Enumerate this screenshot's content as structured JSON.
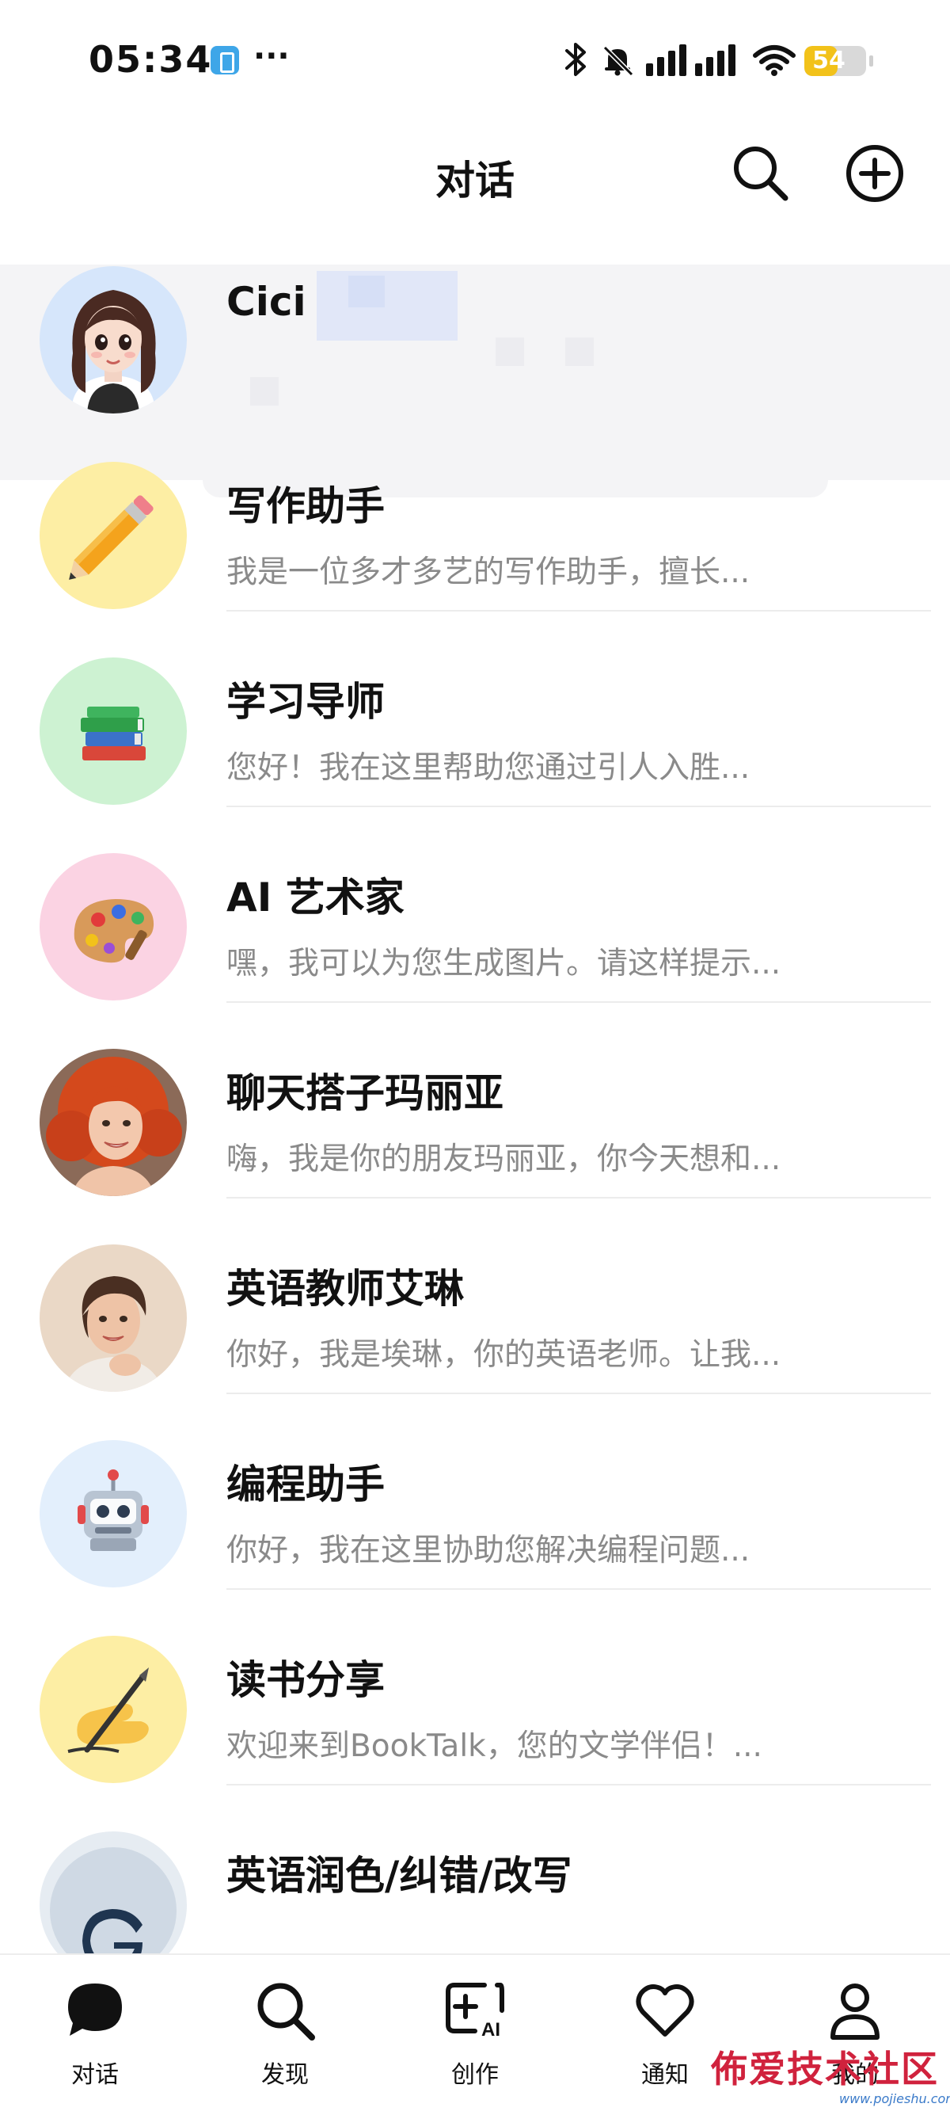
{
  "status_bar": {
    "time": "05:34",
    "more": "···",
    "battery": "54",
    "battery_fraction": 0.54
  },
  "header": {
    "title": "对话",
    "search_icon": "search-icon",
    "add_icon": "plus-circle-icon"
  },
  "chats": [
    {
      "name": "Cici",
      "preview": "",
      "avatar": "cici-girl-avatar",
      "avatar_bg": "#d6e6fb"
    },
    {
      "name": "写作助手",
      "preview": "我是一位多才多艺的写作助手，擅长...",
      "avatar": "pencil-icon",
      "avatar_bg": "#fdeea4"
    },
    {
      "name": "学习导师",
      "preview": "您好！我在这里帮助您通过引人入胜...",
      "avatar": "books-icon",
      "avatar_bg": "#cdf2d2"
    },
    {
      "name": "AI 艺术家",
      "preview": "嘿，我可以为您生成图片。请这样提示...",
      "avatar": "palette-icon",
      "avatar_bg": "#fbd3e3"
    },
    {
      "name": "聊天搭子玛丽亚",
      "preview": "嗨，我是你的朋友玛丽亚，你今天想和...",
      "avatar": "maria-photo",
      "avatar_bg": "#e9b89a"
    },
    {
      "name": "英语教师艾琳",
      "preview": "你好，我是埃琳，你的英语老师。让我...",
      "avatar": "irene-photo",
      "avatar_bg": "#ead8c6"
    },
    {
      "name": "编程助手",
      "preview": "你好，我在这里协助您解决编程问题...",
      "avatar": "robot-icon",
      "avatar_bg": "#e3effc"
    },
    {
      "name": "读书分享",
      "preview": "欢迎来到BookTalk，您的文学伴侣！...",
      "avatar": "writing-hand-icon",
      "avatar_bg": "#fdeea4"
    },
    {
      "name": "英语润色/纠错/改写",
      "preview": "",
      "avatar": "g-letter-icon",
      "avatar_bg": "#e6ecf2"
    }
  ],
  "bottom_nav": [
    {
      "label": "对话",
      "icon": "chat-bubble-icon",
      "active": true
    },
    {
      "label": "发现",
      "icon": "search-icon",
      "active": false
    },
    {
      "label": "创作",
      "icon": "create-ai-icon",
      "active": false
    },
    {
      "label": "通知",
      "icon": "heart-icon",
      "active": false
    },
    {
      "label": "我的",
      "icon": "profile-icon",
      "active": false
    }
  ],
  "watermark": {
    "text": "佈爱技术社区",
    "url": "www.pojieshu.com"
  }
}
